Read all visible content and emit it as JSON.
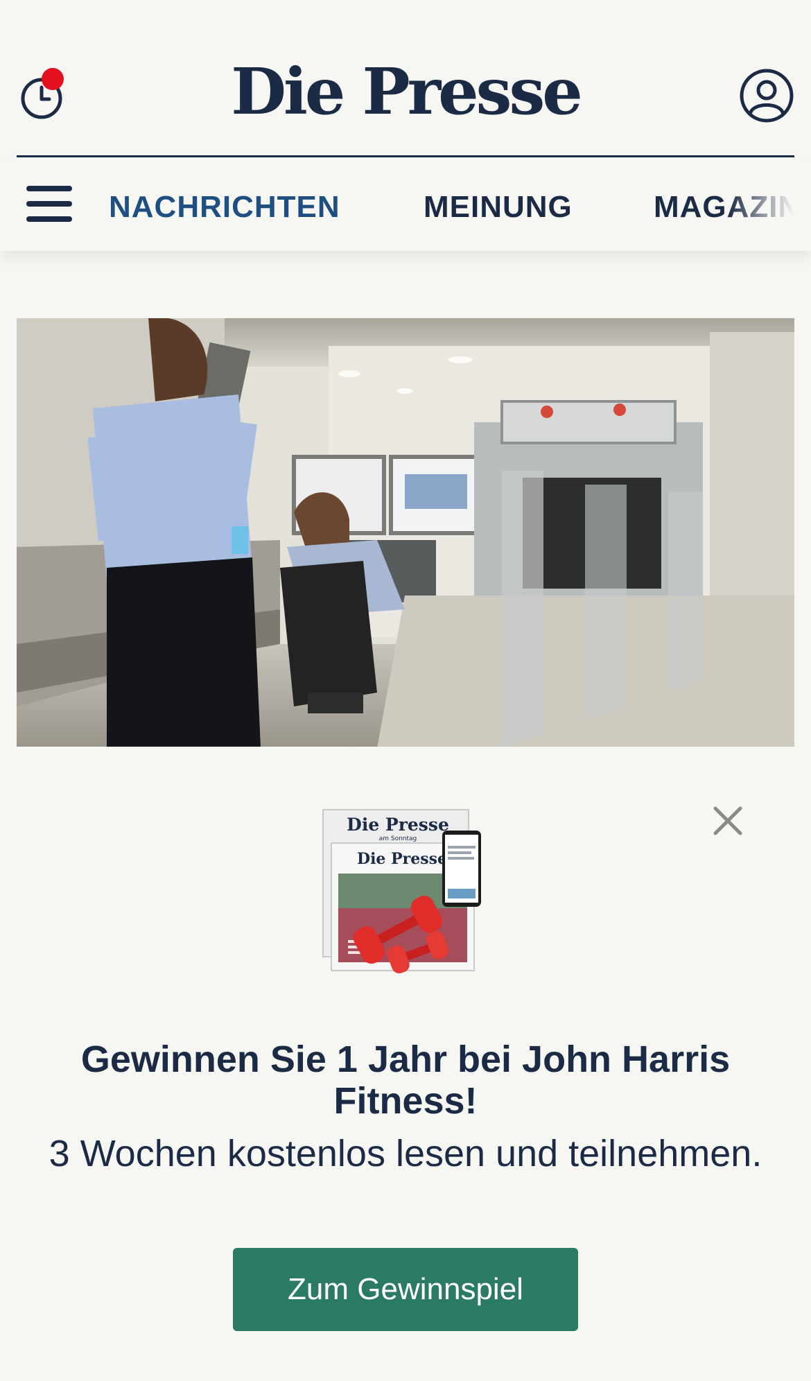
{
  "header": {
    "logo_text": "Die Presse",
    "history_icon": "clock-icon",
    "notification_dot_color": "#e3101f",
    "account_icon": "user-circle-icon"
  },
  "nav": {
    "menu_icon": "hamburger-icon",
    "items": [
      {
        "label": "NACHRICHTEN",
        "active": true
      },
      {
        "label": "MEINUNG",
        "active": false
      },
      {
        "label": "MAGAZIN",
        "active": false
      }
    ]
  },
  "promo": {
    "image_logo_top": "Die Presse",
    "image_logo_top_sub": "am Sonntag",
    "image_logo_bottom": "Die Presse",
    "title": "Gewinnen Sie 1 Jahr bei John Harris Fitness!",
    "subtitle": "3 Wochen kostenlos lesen und teilnehmen.",
    "cta_label": "Zum Gewinnspiel"
  },
  "colors": {
    "brand_navy": "#1b2a45",
    "nav_active": "#1f4e82",
    "cta_green": "#2a7a64",
    "background": "#f6f6f2"
  }
}
